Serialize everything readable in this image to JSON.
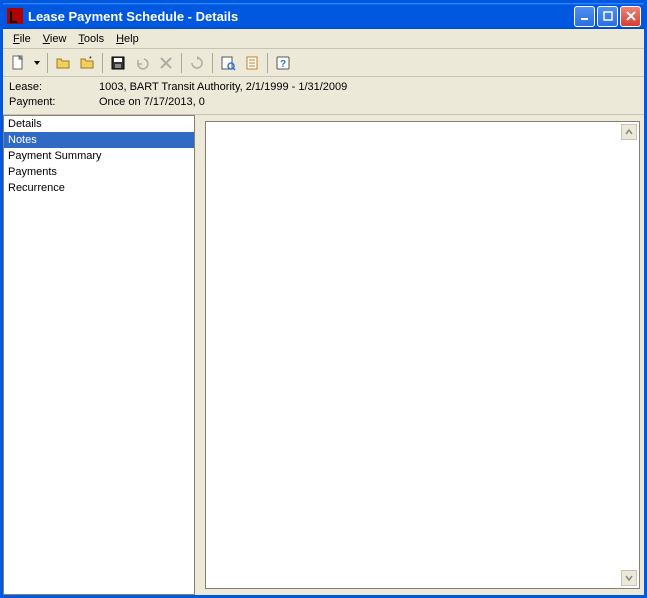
{
  "window": {
    "title": "Lease Payment Schedule - Details"
  },
  "menu": {
    "file": "File",
    "view": "View",
    "tools": "Tools",
    "help": "Help"
  },
  "info": {
    "lease_label": "Lease:",
    "lease_value": "1003, BART Transit Authority, 2/1/1999 - 1/31/2009",
    "payment_label": "Payment:",
    "payment_value": "Once on 7/17/2013, 0"
  },
  "sidebar": {
    "items": [
      {
        "label": "Details"
      },
      {
        "label": "Notes"
      },
      {
        "label": "Payment Summary"
      },
      {
        "label": "Payments"
      },
      {
        "label": "Recurrence"
      }
    ],
    "selected_index": 1
  },
  "icons": {
    "new": "new-document-icon",
    "new_dropdown": "dropdown-icon",
    "open": "open-folder-icon",
    "open_recent": "open-recent-icon",
    "save": "save-icon",
    "undo": "undo-icon",
    "delete": "delete-icon",
    "refresh": "refresh-icon",
    "preview": "preview-icon",
    "doc2": "document-icon",
    "help": "help-icon"
  }
}
